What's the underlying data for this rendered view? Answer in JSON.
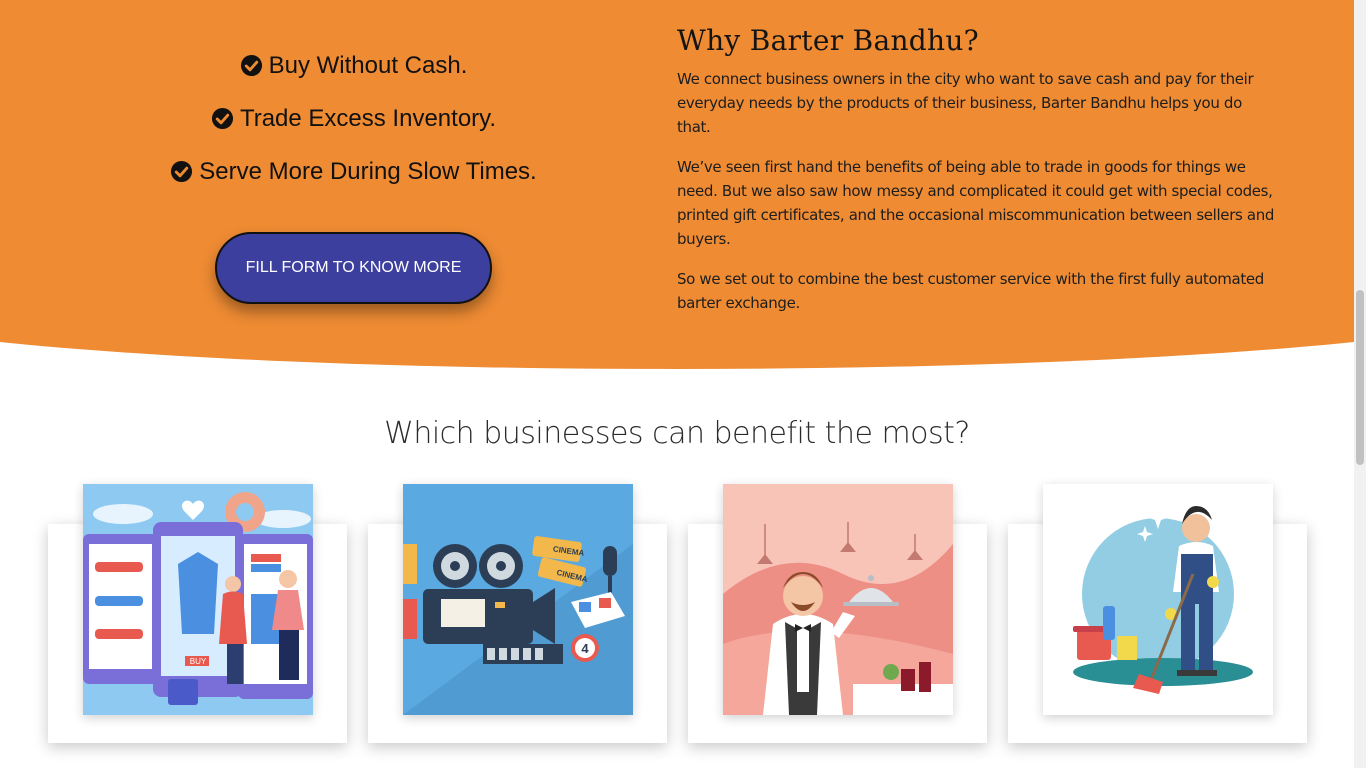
{
  "colors": {
    "hero_orange": "#ee8b33",
    "button_blue": "#3c3f9e",
    "text_dark": "#1d1d1d"
  },
  "checklist": [
    {
      "icon": "check-circle-icon",
      "text": "Buy Without Cash."
    },
    {
      "icon": "check-circle-icon",
      "text": "Trade Excess Inventory."
    },
    {
      "icon": "check-circle-icon",
      "text": "Serve More During Slow Times."
    }
  ],
  "cta": {
    "label": "FILL FORM TO KNOW MORE"
  },
  "why": {
    "title": "Why Barter Bandhu?",
    "paragraphs": [
      "We connect business owners in the city who want to save cash and pay for their everyday needs by the products of their business, Barter Bandhu helps you do that.",
      "We’ve seen first hand the benefits of being able to trade in goods for things we need. But we also saw how messy and complicated it could get with special codes, printed gift certificates, and the occasional miscommunication between sellers and buyers.",
      "So we set out to combine the best customer service with the first fully automated barter exchange."
    ]
  },
  "businesses": {
    "title": "Which businesses can benefit the most?",
    "cards": [
      {
        "image": "retail-shopping-illustration",
        "badge": "BUY"
      },
      {
        "image": "cinema-entertainment-illustration",
        "tickets": [
          "CINEMA",
          "CINEMA"
        ],
        "number": "4"
      },
      {
        "image": "restaurant-waiter-illustration"
      },
      {
        "image": "cleaning-service-illustration"
      }
    ]
  }
}
